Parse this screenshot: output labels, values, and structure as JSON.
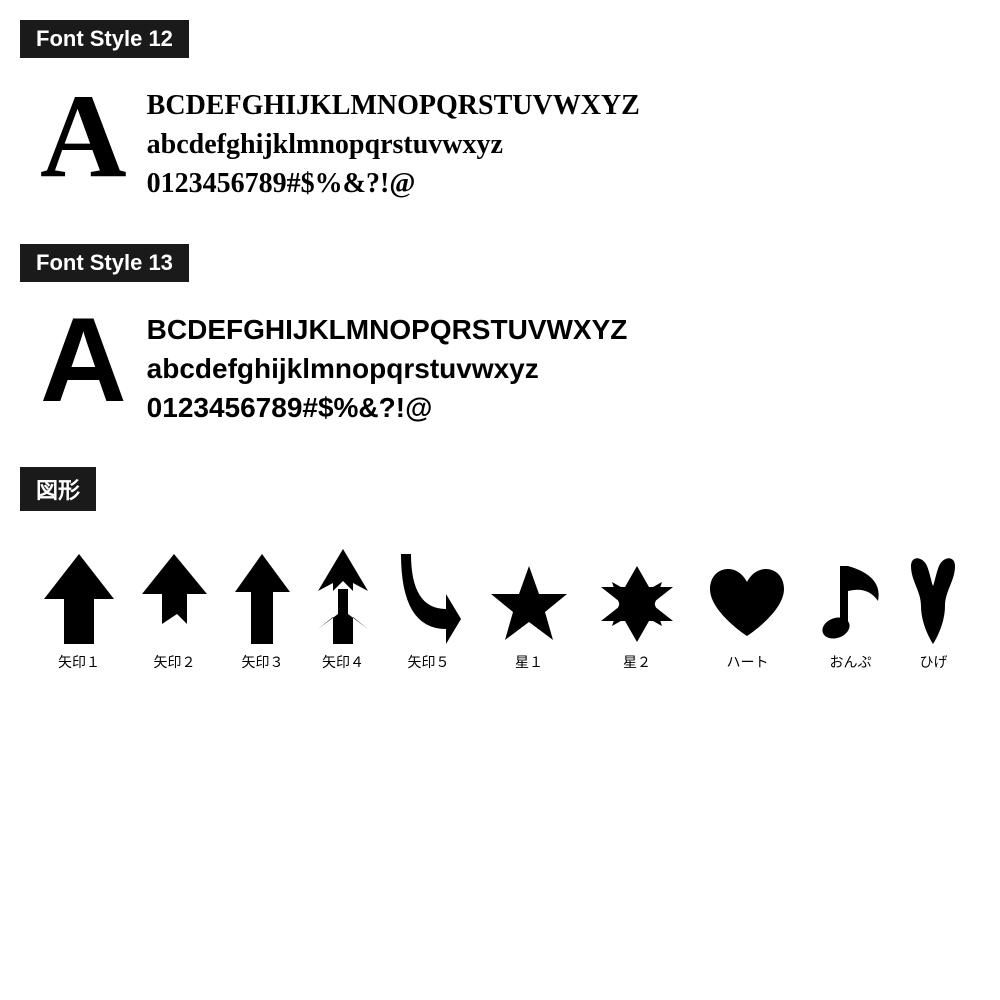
{
  "font12": {
    "label": "Font Style 12",
    "big_letter": "A",
    "lines": [
      "BCDEFGHIJKLMNOPQRSTUVWXYZ",
      "abcdefghijklmnopqrstuvwxyz",
      "0123456789#$%&?!@"
    ]
  },
  "font13": {
    "label": "Font Style 13",
    "big_letter": "A",
    "lines": [
      "BCDEFGHIJKLMNOPQRSTUVWXYZ",
      "abcdefghijklmnopqrstuvwxyz",
      "0123456789#$%&?!@"
    ]
  },
  "shapes": {
    "label": "図形",
    "items": [
      {
        "name": "矢印１",
        "icon": "arrow1"
      },
      {
        "name": "矢印２",
        "icon": "arrow2"
      },
      {
        "name": "矢印３",
        "icon": "arrow3"
      },
      {
        "name": "矢印４",
        "icon": "arrow4"
      },
      {
        "name": "矢印５",
        "icon": "arrow5"
      },
      {
        "name": "星１",
        "icon": "star1"
      },
      {
        "name": "星２",
        "icon": "star2"
      },
      {
        "name": "ハート",
        "icon": "heart"
      },
      {
        "name": "おんぷ",
        "icon": "music"
      },
      {
        "name": "ひげ",
        "icon": "mustache"
      }
    ]
  }
}
